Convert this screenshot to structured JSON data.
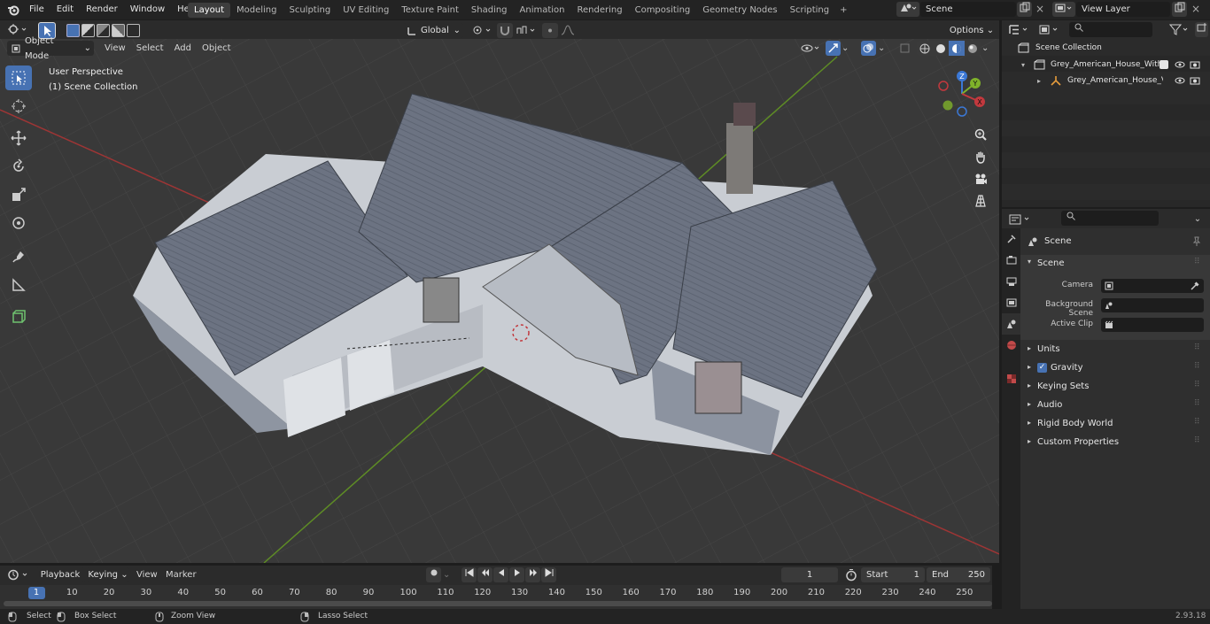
{
  "topbar": {
    "menus": [
      "File",
      "Edit",
      "Render",
      "Window",
      "Help"
    ],
    "workspaces": [
      "Layout",
      "Modeling",
      "Sculpting",
      "UV Editing",
      "Texture Paint",
      "Shading",
      "Animation",
      "Rendering",
      "Compositing",
      "Geometry Nodes",
      "Scripting"
    ],
    "active_workspace": "Layout",
    "plus": "+",
    "scene_name": "Scene",
    "view_layer": "View Layer"
  },
  "viewport_header": {
    "transform_orientation": "Global",
    "options": "Options",
    "mode": "Object Mode",
    "menus": [
      "View",
      "Select",
      "Add",
      "Object"
    ]
  },
  "viewport": {
    "perspective": "User Perspective",
    "collection": "(1) Scene Collection",
    "gizmo": {
      "x": "X",
      "y": "Y",
      "z": "Z"
    }
  },
  "outliner": {
    "root": "Scene Collection",
    "items": [
      {
        "name": "Grey_American_House_With_"
      },
      {
        "name": "Grey_American_House_V"
      }
    ]
  },
  "properties": {
    "header": "Scene",
    "panel": "Scene",
    "camera_label": "Camera",
    "bg_scene_label": "Background Scene",
    "active_clip_label": "Active Clip",
    "sections": [
      "Units",
      "Gravity",
      "Keying Sets",
      "Audio",
      "Rigid Body World",
      "Custom Properties"
    ]
  },
  "timeline": {
    "menus": [
      "Playback",
      "Keying",
      "View",
      "Marker"
    ],
    "current_frame": "1",
    "start_label": "Start",
    "start_value": "1",
    "end_label": "End",
    "end_value": "250",
    "ruler": [
      "1",
      "10",
      "20",
      "30",
      "40",
      "50",
      "60",
      "70",
      "80",
      "90",
      "100",
      "110",
      "120",
      "130",
      "140",
      "150",
      "160",
      "170",
      "180",
      "190",
      "200",
      "210",
      "220",
      "230",
      "240",
      "250"
    ]
  },
  "status": {
    "items": [
      "Select",
      "Box Select",
      "Zoom View",
      "Lasso Select"
    ],
    "version": "2.93.18"
  },
  "colors": {
    "accent": "#4772b3",
    "axis_x": "#c2393e",
    "axis_y": "#7fb22a",
    "axis_z": "#3b78d6"
  }
}
